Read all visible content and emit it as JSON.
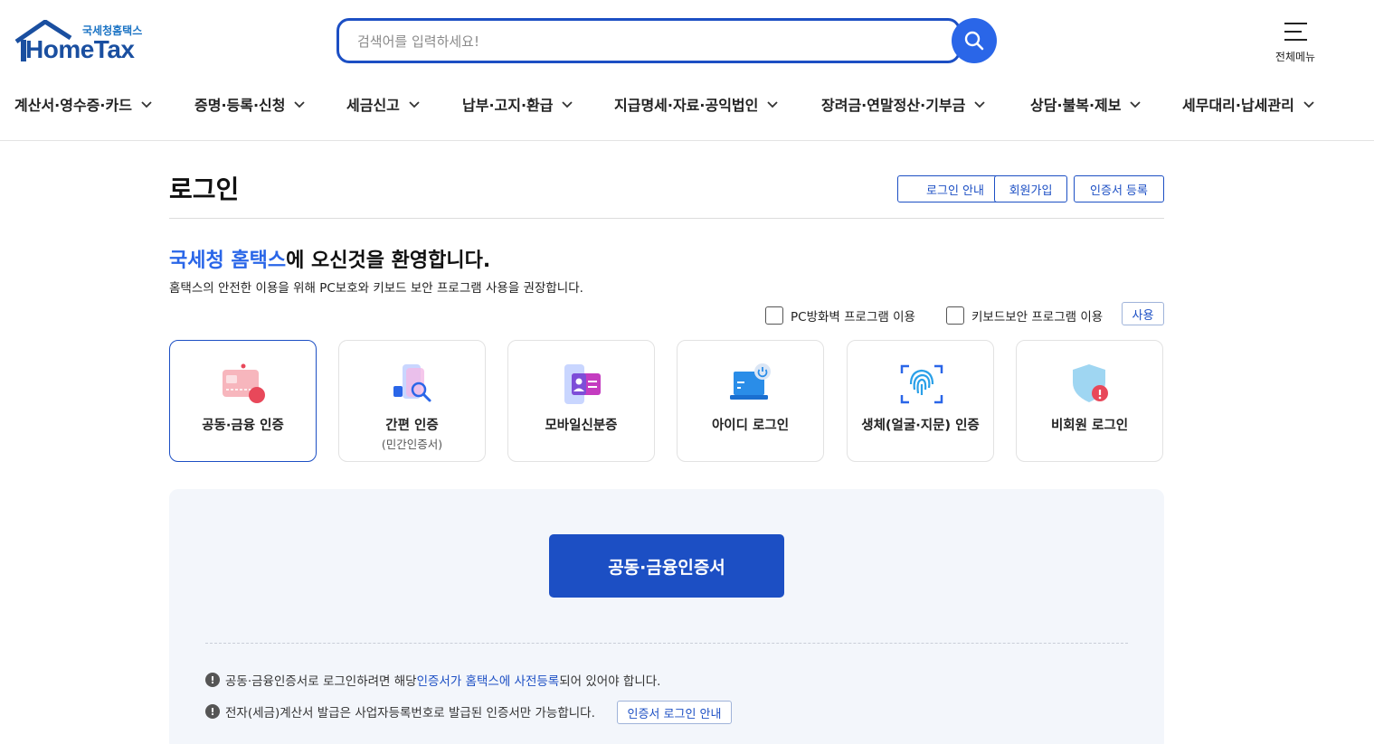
{
  "header": {
    "logo_small": "국세청홈택스",
    "logo_big": "HomeTax",
    "search_placeholder": "검색어를 입력하세요!",
    "allmenu_label": "전체메뉴"
  },
  "nav": [
    {
      "label": "계산서·영수증·카드"
    },
    {
      "label": "증명·등록·신청"
    },
    {
      "label": "세금신고"
    },
    {
      "label": "납부·고지·환급"
    },
    {
      "label": "지급명세·자료·공익법인"
    },
    {
      "label": "장려금·연말정산·기부금"
    },
    {
      "label": "상담·불복·제보"
    },
    {
      "label": "세무대리·납세관리"
    }
  ],
  "page": {
    "title": "로그인",
    "top_buttons": [
      "로그인 안내",
      "회원가입",
      "인증서 등록"
    ],
    "welcome_highlight": "국세청 홈택스",
    "welcome_rest": "에 오신것을 환영합니다.",
    "subtext": "홈택스의 안전한 이용을 위해 PC보호와 키보드 보안 프로그램 사용을 권장합니다.",
    "checkboxes": [
      "PC방화벽 프로그램 이용",
      "키보드보안 프로그램 이용"
    ],
    "use_button": "사용"
  },
  "login_methods": [
    {
      "label": "공동·금융 인증",
      "sub": "",
      "icon": "certificate-card-icon",
      "active": true
    },
    {
      "label": "간편 인증",
      "sub": "(민간인증서)",
      "icon": "simple-auth-phone-icon",
      "active": false
    },
    {
      "label": "모바일신분증",
      "sub": "",
      "icon": "mobile-id-icon",
      "active": false
    },
    {
      "label": "아이디 로그인",
      "sub": "",
      "icon": "laptop-power-icon",
      "active": false
    },
    {
      "label": "생체(얼굴·지문) 인증",
      "sub": "",
      "icon": "fingerprint-icon",
      "active": false
    },
    {
      "label": "비회원 로그인",
      "sub": "",
      "icon": "shield-icon",
      "active": false
    }
  ],
  "panel": {
    "primary_button": "공동·금융인증서",
    "note1_pre": "공동·금융인증서로 로그인하려면 해당 ",
    "note1_link": "인증서가 홈택스에 사전등록",
    "note1_post": "되어 있어야 합니다.",
    "note2": "전자(세금)계산서 발급은 사업자등록번호로 발급된 인증서만 가능합니다.",
    "note2_button": "인증서 로그인 안내"
  },
  "colors": {
    "primary": "#1c4fc4",
    "accent": "#2a66e8",
    "panel_bg": "#f3f6fb"
  }
}
